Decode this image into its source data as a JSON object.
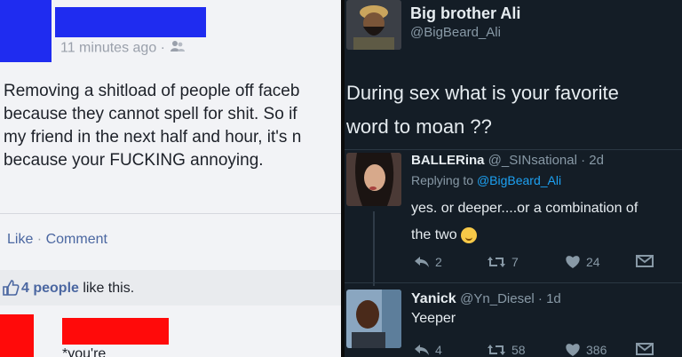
{
  "facebook_post": {
    "timestamp": "11 minutes ago ·",
    "audience_icon": "friends-icon",
    "body_lines": [
      "Removing a shitload of people off faceb",
      "because they cannot spell for shit. So if",
      "my friend in the next half and hour, it's n",
      "because your FUCKING annoying."
    ],
    "like_label": "Like",
    "separator": " · ",
    "comment_label": "Comment",
    "likes_count_label": "4 people",
    "likes_suffix": " like this.",
    "comment_text": "*you're",
    "redaction_color": "#1f2cf0",
    "redaction_color_comment": "#ff0a0a"
  },
  "tweet": {
    "author_name": "Big brother Ali",
    "author_handle": "@BigBeard_Ali",
    "text_line1": "During sex what is your favorite",
    "text_line2": "word to moan ??"
  },
  "replies": [
    {
      "name": "BALLERina",
      "handle": "@_SINsational · 2d",
      "replying_prefix": "Replying to ",
      "replying_to": "@BigBeard_Ali",
      "text_line1": "yes. or deeper....or a combination of",
      "text_line2": "the two",
      "emoji": "upside-down-face",
      "reply_count": "2",
      "retweet_count": "7",
      "like_count": "24"
    },
    {
      "name": "Yanick",
      "handle": "@Yn_Diesel · 1d",
      "text": "Yeeper",
      "reply_count": "4",
      "retweet_count": "58",
      "like_count": "386"
    }
  ],
  "colors": {
    "twitter_bg": "#141d26",
    "twitter_link": "#1da1f2",
    "facebook_link": "#4b67a1"
  }
}
